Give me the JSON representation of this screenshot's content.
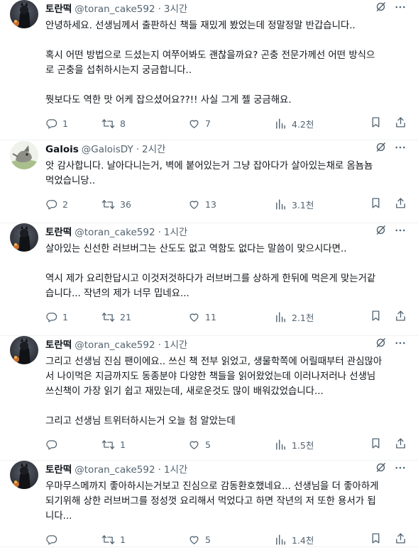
{
  "tweets": [
    {
      "name": "토란떡",
      "handle": "@toran_cake592",
      "sep": "·",
      "time": "3시간",
      "paragraphs": [
        "안녕하세요. 선생님께서 출판하신 책들 재밌게 봤었는데 정말정말 반갑습니다..",
        "혹시 어떤 방법으로 드셨는지 여쭈어봐도 괜찮을까요? 곤충 전문가께선 어떤 방식으\n로 곤충을 섭취하시는지 궁금합니다..",
        "뭣보다도 역한 맛 어케 잡으셨어요??!! 사실 그게 젤 궁금해요."
      ],
      "replies": "1",
      "retweets": "8",
      "likes": "7",
      "views": "4.2천"
    },
    {
      "name": "Galois",
      "handle": "@GaloisDY",
      "sep": "·",
      "time": "2시간",
      "paragraphs": [
        "앗 감사합니다. 날아다니는거, 벽에 붙어있는거 그냥 잡아다가 살아있는채로 옴뇸뇸\n먹었습니당.."
      ],
      "replies": "2",
      "retweets": "36",
      "likes": "13",
      "views": "3.1천"
    },
    {
      "name": "토란떡",
      "handle": "@toran_cake592",
      "sep": "·",
      "time": "1시간",
      "paragraphs": [
        "살아있는 신선한 러브버그는 산도도 없고 역함도 없다는 말씀이 맞으시다면..",
        "역시 제가 요리한답시고 이것저것하다가 러브버그를 상하게 한뒤에 먹은게 맞는거같\n습니다... 작년의 제가 너무 밉네요..."
      ],
      "replies": "1",
      "retweets": "21",
      "likes": "11",
      "views": "2.1천"
    },
    {
      "name": "토란떡",
      "handle": "@toran_cake592",
      "sep": "·",
      "time": "1시간",
      "paragraphs": [
        "그리고 선생님 진심 팬이에요.. 쓰신 책 전부 읽었고, 생물학쪽에 어릴때부터 관심많아\n서 나이먹은 지금까지도 동종분야 다양한 책들을 읽어왔었는데 이러나저러나 선생님\n쓰신책이 가장 읽기 쉽고 재밌는데, 새로운것도 많이 배워갔었습니다...",
        "그리고 선생님 트위터하시는거 오늘 첨 알았는데"
      ],
      "replies": "",
      "retweets": "1",
      "likes": "5",
      "views": "1.5천"
    },
    {
      "name": "토란떡",
      "handle": "@toran_cake592",
      "sep": "·",
      "time": "1시간",
      "paragraphs": [
        "우마무스메까지 좋아하시는거보고 진심으로 감동환호했네요... 선생님을 더 좋아하게\n되기위해 상한 러브버그를 정성껏 요리해서 먹었다고 하면 작년의 저 또한 용서가 됩\n니다..."
      ],
      "replies": "",
      "retweets": "1",
      "likes": "5",
      "views": "1.4천"
    }
  ]
}
